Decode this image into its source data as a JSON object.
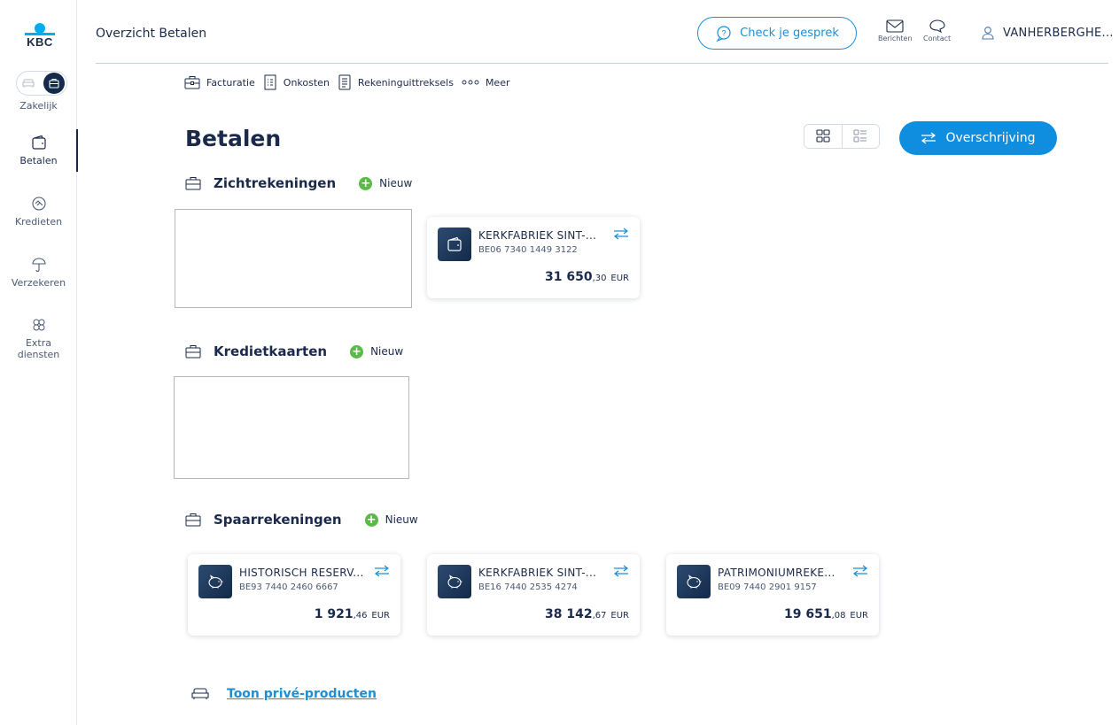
{
  "brand": {
    "logo_text": "KBC",
    "accent": "#00aeef",
    "primary_blue": "#0f8ee0",
    "navy": "#132a4a",
    "green": "#5bb94a"
  },
  "sidebar": {
    "toggle_label": "Zakelijk",
    "items": [
      {
        "label": "Betalen",
        "icon": "wallet-icon",
        "active": true
      },
      {
        "label": "Kredieten",
        "icon": "handshake-icon",
        "active": false
      },
      {
        "label": "Verzekeren",
        "icon": "umbrella-icon",
        "active": false
      },
      {
        "label": "Extra diensten",
        "icon": "flower-icon",
        "active": false
      }
    ]
  },
  "header": {
    "title": "Overzicht Betalen",
    "check_button": "Check je gesprek",
    "messages_label": "Berichten",
    "contact_label": "Contact",
    "user_name": "VANHERBERGHE..."
  },
  "subnav": {
    "items": [
      {
        "label": "Facturatie",
        "icon": "invoice-icon"
      },
      {
        "label": "Onkosten",
        "icon": "receipt-icon"
      },
      {
        "label": "Rekeninguittreksels",
        "icon": "statement-icon"
      },
      {
        "label": "Meer",
        "icon": "more-dots-icon"
      }
    ]
  },
  "page": {
    "title": "Betalen",
    "transfer_button": "Overschrijving"
  },
  "sections": {
    "zicht": {
      "title": "Zichtrekeningen",
      "new_label": "Nieuw",
      "accounts": [
        {
          "name": "KERKFABRIEK SINT-...",
          "iban": "BE06 7340 1449 3122",
          "balance_int": "31 650",
          "balance_dec": ",30",
          "currency": "EUR",
          "icon": "wallet-icon"
        }
      ]
    },
    "krediet": {
      "title": "Kredietkaarten",
      "new_label": "Nieuw"
    },
    "spaar": {
      "title": "Spaarrekeningen",
      "new_label": "Nieuw",
      "accounts": [
        {
          "name": "HISTORISCH RESERV...",
          "iban": "BE93 7440 2460 6667",
          "balance_int": "1 921",
          "balance_dec": ",46",
          "currency": "EUR",
          "icon": "piggy-bank-icon"
        },
        {
          "name": "KERKFABRIEK SINT-...",
          "iban": "BE16 7440 2535 4274",
          "balance_int": "38 142",
          "balance_dec": ",67",
          "currency": "EUR",
          "icon": "piggy-bank-icon"
        },
        {
          "name": "PATRIMONIUMREKE...",
          "iban": "BE09 7440 2901 9157",
          "balance_int": "19 651",
          "balance_dec": ",08",
          "currency": "EUR",
          "icon": "piggy-bank-icon"
        }
      ]
    }
  },
  "footer": {
    "private_link": "Toon privé-producten"
  }
}
